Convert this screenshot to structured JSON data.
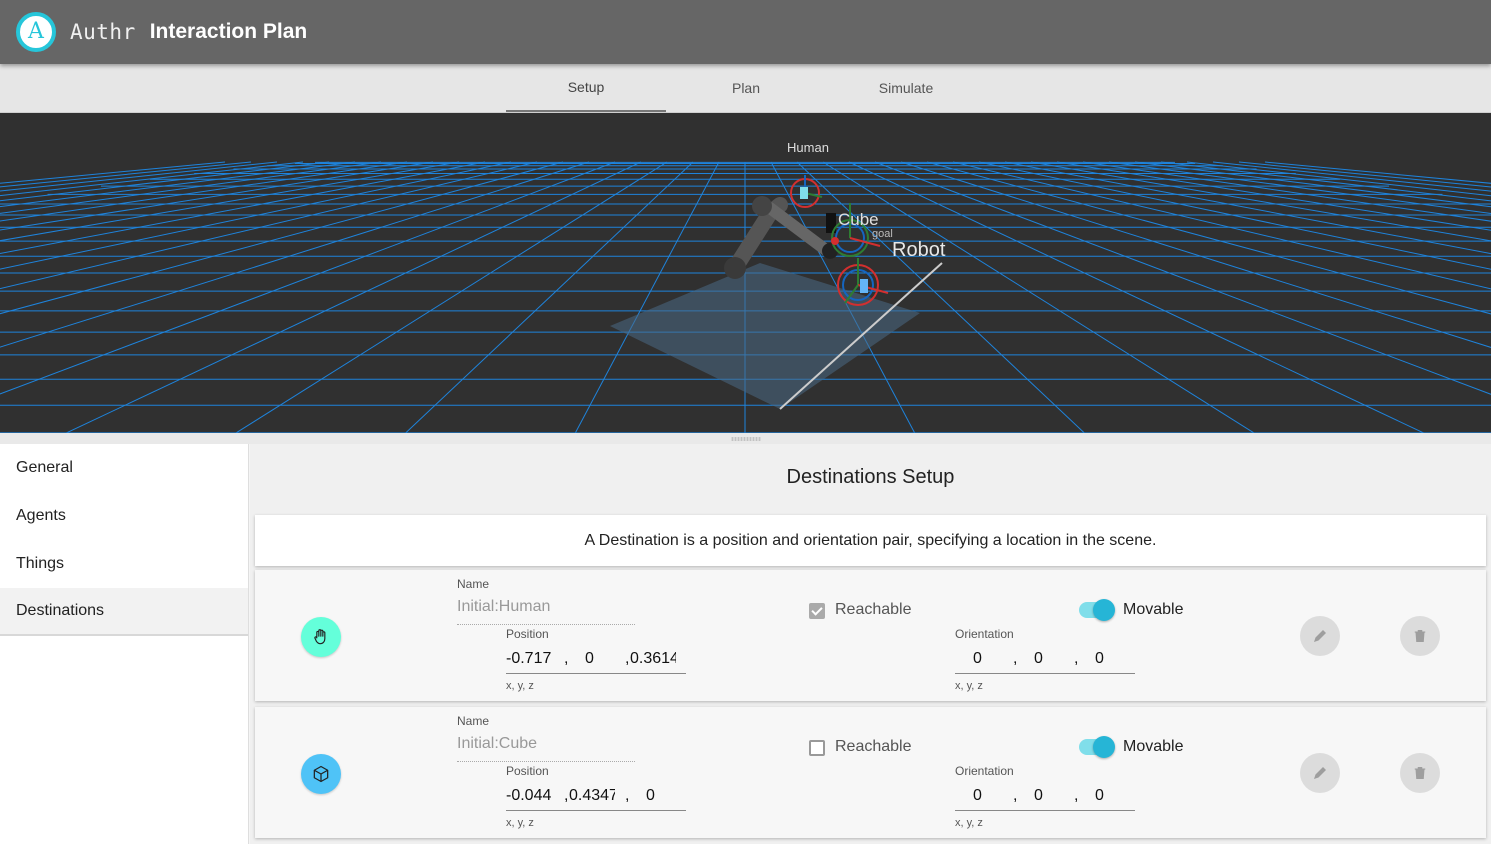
{
  "header": {
    "logo_letter": "A",
    "brand": "Authr",
    "title": "Interaction Plan"
  },
  "tabs": [
    {
      "label": "Setup",
      "active": true
    },
    {
      "label": "Plan",
      "active": false
    },
    {
      "label": "Simulate",
      "active": false
    }
  ],
  "scene": {
    "labels": {
      "human": "Human",
      "cube": "Cube",
      "goal": "goal",
      "robot": "Robot"
    },
    "grid_color": "#1e88e5",
    "background": "#303030"
  },
  "sidebar": {
    "items": [
      {
        "label": "General",
        "active": false
      },
      {
        "label": "Agents",
        "active": false
      },
      {
        "label": "Things",
        "active": false
      },
      {
        "label": "Destinations",
        "active": true
      }
    ]
  },
  "main": {
    "title": "Destinations Setup",
    "description": "A Destination is a position and orientation pair, specifying a location in the scene.",
    "labels": {
      "name": "Name",
      "position": "Position",
      "orientation": "Orientation",
      "xyz": "x, y, z",
      "reachable": "Reachable",
      "movable": "Movable"
    },
    "destinations": [
      {
        "name": "Initial:Human",
        "icon": "hand-icon",
        "color": "#64ffda",
        "position": [
          "-0.717",
          "0",
          "0.3614"
        ],
        "orientation": [
          "0",
          "0",
          "0"
        ],
        "reachable": true,
        "movable": true
      },
      {
        "name": "Initial:Cube",
        "icon": "cube-icon",
        "color": "#4fc3f7",
        "position": [
          "-0.044",
          "0.4347",
          "0"
        ],
        "orientation": [
          "0",
          "0",
          "0"
        ],
        "reachable": false,
        "movable": true
      }
    ]
  }
}
